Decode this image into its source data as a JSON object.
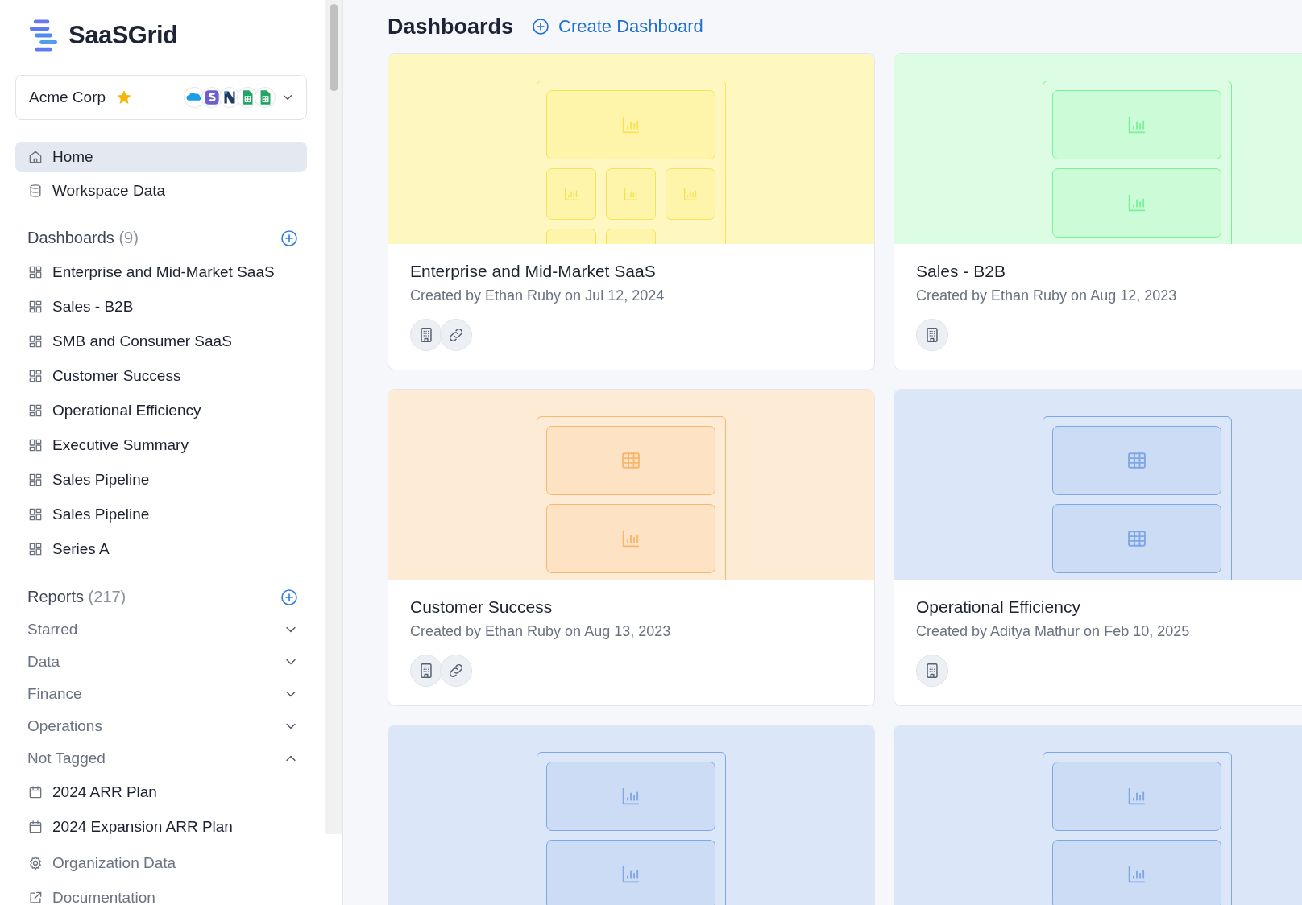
{
  "brand": {
    "name": "SaaSGrid"
  },
  "org": {
    "name": "Acme Corp",
    "starred": true,
    "integrations": [
      {
        "kind": "cloud"
      },
      {
        "kind": "purple"
      },
      {
        "kind": "navy"
      },
      {
        "kind": "sheet"
      },
      {
        "kind": "sheet"
      }
    ]
  },
  "nav": [
    {
      "label": "Home",
      "selected": true
    },
    {
      "label": "Workspace Data",
      "selected": false
    }
  ],
  "dashboards_section": {
    "title": "Dashboards",
    "count": "(9)",
    "items": [
      {
        "label": "Enterprise and Mid-Market SaaS"
      },
      {
        "label": "Sales - B2B"
      },
      {
        "label": "SMB and Consumer SaaS"
      },
      {
        "label": "Customer Success"
      },
      {
        "label": "Operational Efficiency"
      },
      {
        "label": "Executive Summary"
      },
      {
        "label": "Sales Pipeline"
      },
      {
        "label": "Sales Pipeline"
      },
      {
        "label": "Series A"
      }
    ]
  },
  "reports_section": {
    "title": "Reports",
    "count": "(217)",
    "groups": [
      {
        "label": "Starred",
        "expanded": false
      },
      {
        "label": "Data",
        "expanded": false
      },
      {
        "label": "Finance",
        "expanded": false
      },
      {
        "label": "Operations",
        "expanded": false
      },
      {
        "label": "Not Tagged",
        "expanded": true,
        "children": [
          {
            "label": "2024 ARR Plan"
          },
          {
            "label": "2024 Expansion ARR Plan"
          }
        ]
      }
    ]
  },
  "footer_links": [
    {
      "label": "Organization Data"
    },
    {
      "label": "Documentation"
    }
  ],
  "main": {
    "title": "Dashboards",
    "create_label": "Create Dashboard"
  },
  "cards": [
    {
      "title": "Enterprise and Mid-Market SaaS",
      "subtitle": "Created by Ethan Ruby on Jul 12, 2024",
      "color": "#fef7c0",
      "tiles": [
        {
          "kind": "wide-chart"
        },
        {
          "kind": "chart"
        },
        {
          "kind": "chart"
        },
        {
          "kind": "chart"
        },
        {
          "kind": "empty"
        },
        {
          "kind": "empty"
        }
      ],
      "badges": [
        {
          "kind": "building"
        },
        {
          "kind": "link"
        }
      ]
    },
    {
      "title": "Sales - B2B",
      "subtitle": "Created by Ethan Ruby on Aug 12, 2023",
      "color": "#dcfce4",
      "tiles": [
        {
          "kind": "wide-chart"
        },
        {
          "kind": "wide-chart"
        }
      ],
      "badges": [
        {
          "kind": "building"
        }
      ]
    },
    {
      "title": "Customer Success",
      "subtitle": "Created by Ethan Ruby on Aug 13, 2023",
      "color": "#feebd5",
      "tiles": [
        {
          "kind": "wide-table"
        },
        {
          "kind": "wide-chart"
        }
      ],
      "badges": [
        {
          "kind": "building"
        },
        {
          "kind": "link"
        }
      ]
    },
    {
      "title": "Operational Efficiency",
      "subtitle": "Created by Aditya Mathur on Feb 10, 2025",
      "color": "#dbe6f8",
      "tiles": [
        {
          "kind": "wide-table"
        },
        {
          "kind": "wide-table"
        }
      ],
      "badges": [
        {
          "kind": "building"
        }
      ]
    },
    {
      "color": "#dbe6f8",
      "tiles": [
        {
          "kind": "wide-chart"
        },
        {
          "kind": "wide-chart"
        }
      ]
    },
    {
      "color": "#dbe6f8",
      "tiles": [
        {
          "kind": "wide-chart"
        },
        {
          "kind": "wide-chart"
        }
      ]
    }
  ]
}
